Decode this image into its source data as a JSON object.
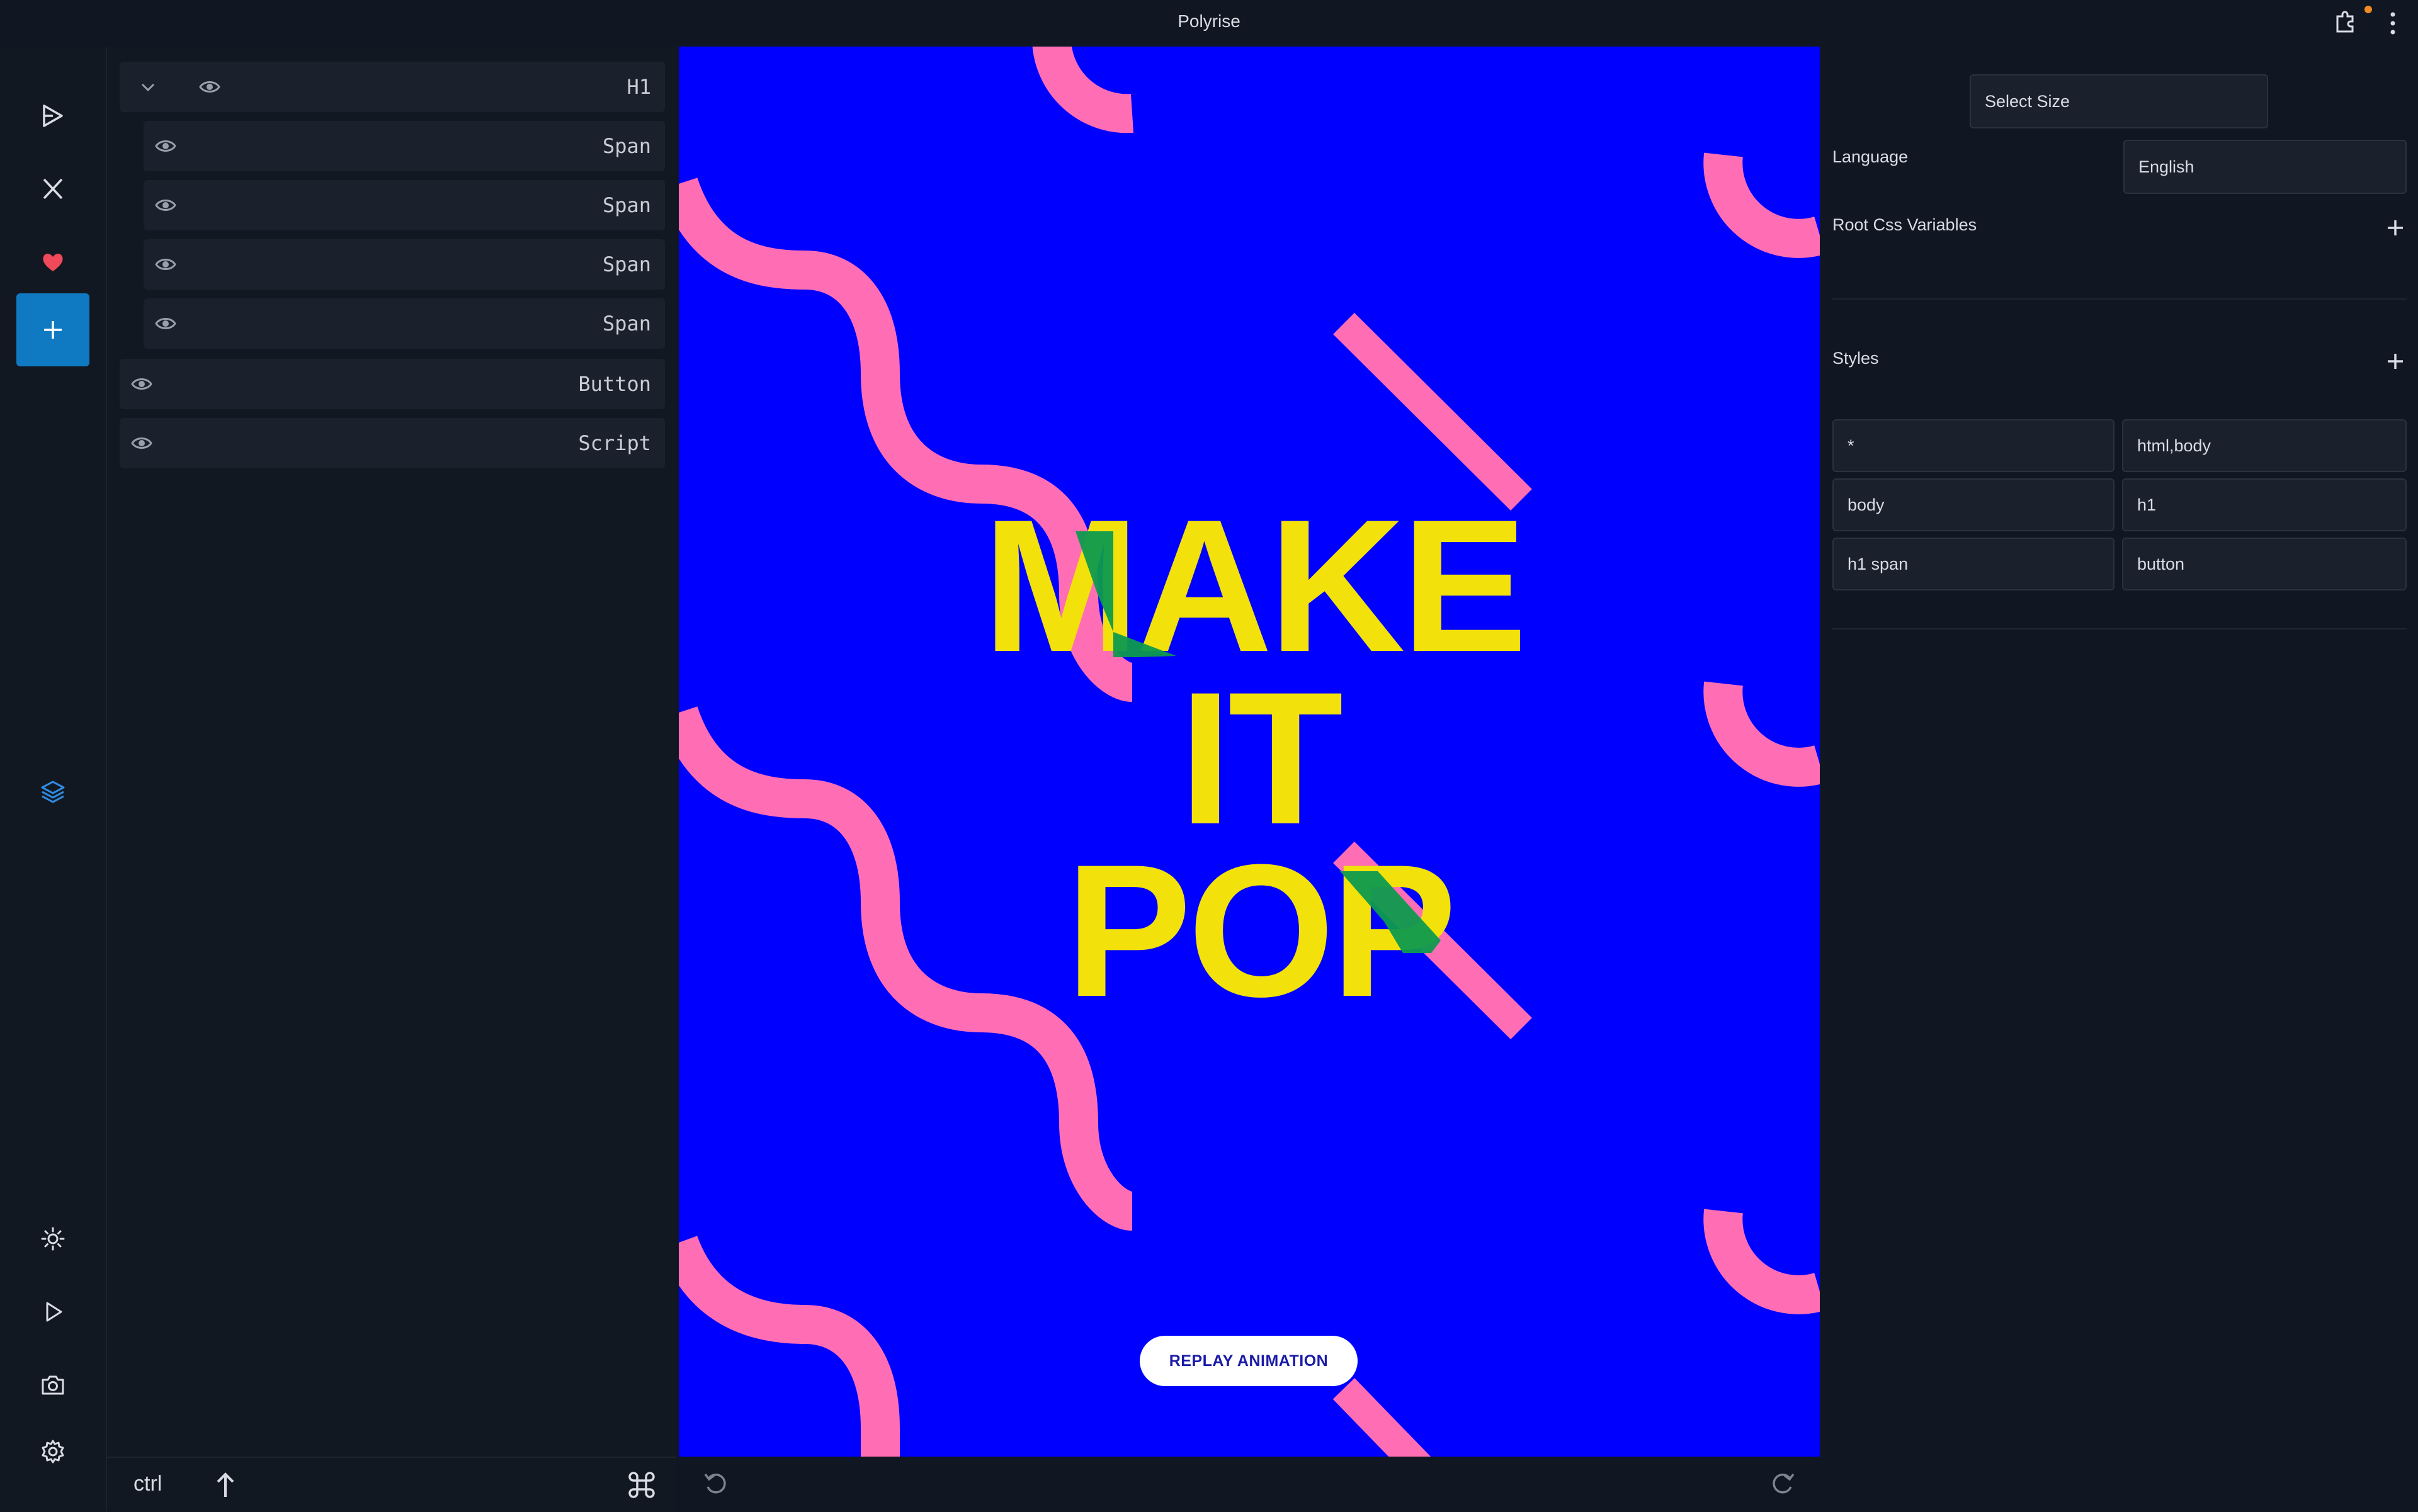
{
  "app": {
    "title": "Polyrise"
  },
  "rail": {
    "icons": [
      "deploy-icon",
      "x-logo-icon",
      "heart-icon",
      "plus-icon",
      "layers-icon",
      "sun-icon",
      "play-icon",
      "camera-icon",
      "gear-icon"
    ]
  },
  "layers": {
    "items": [
      {
        "label": "H1",
        "expanded": true
      },
      {
        "label": "Span"
      },
      {
        "label": "Span"
      },
      {
        "label": "Span"
      },
      {
        "label": "Span"
      },
      {
        "label": "Button"
      },
      {
        "label": "Script"
      }
    ]
  },
  "bottom_bar": {
    "ctrl": "ctrl"
  },
  "canvas": {
    "background": "#0000ff",
    "text_color": "#f2e10a",
    "shape_color": "#ff6eb4",
    "overlap_color": "#0e9a4e",
    "headline": [
      "MAKE",
      "IT",
      "POP"
    ],
    "button": "REPLAY ANIMATION"
  },
  "props": {
    "select_size": "Select Size",
    "language_label": "Language",
    "language_value": "English",
    "root_css_label": "Root Css Variables",
    "styles_label": "Styles",
    "styles": [
      "*",
      "html,body",
      "body",
      "h1",
      "h1 span",
      "button"
    ]
  }
}
